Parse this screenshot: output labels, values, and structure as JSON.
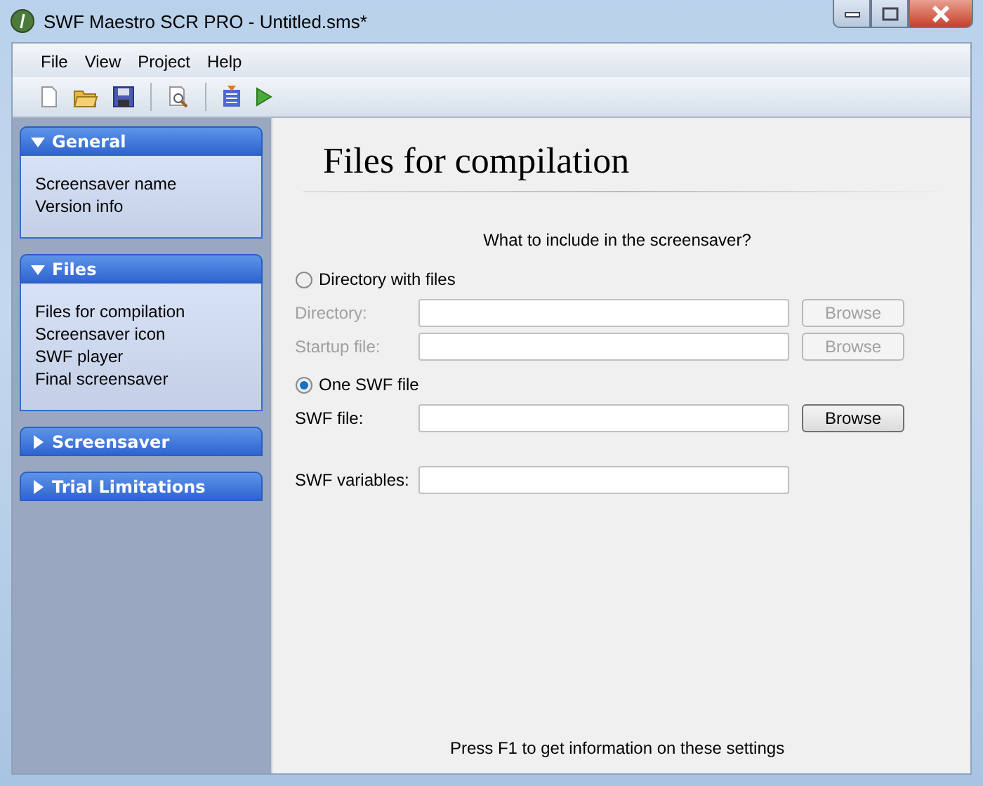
{
  "window": {
    "title": "SWF Maestro SCR PRO - Untitled.sms*"
  },
  "menu": [
    "File",
    "View",
    "Project",
    "Help"
  ],
  "sidebar": {
    "groups": [
      {
        "title": "General",
        "expanded": true,
        "items": [
          "Screensaver name",
          "Version info"
        ]
      },
      {
        "title": "Files",
        "expanded": true,
        "items": [
          "Files for compilation",
          "Screensaver icon",
          "SWF player",
          "Final screensaver"
        ]
      },
      {
        "title": "Screensaver",
        "expanded": false
      },
      {
        "title": "Trial Limitations",
        "expanded": false
      }
    ]
  },
  "page": {
    "heading": "Files for compilation",
    "prompt": "What to include in the screensaver?",
    "sources": [
      {
        "label": "Directory with files",
        "selected": false,
        "fields": [
          {
            "label": "Directory:",
            "button": "Browse"
          },
          {
            "label": "Startup file:",
            "button": "Browse"
          }
        ]
      },
      {
        "label": "One SWF file",
        "selected": true,
        "fields": [
          {
            "label": "SWF file:",
            "button": "Browse"
          }
        ]
      }
    ],
    "extra_fields": [
      {
        "label": "SWF variables:"
      }
    ],
    "hint": "Press F1 to get information on these settings"
  }
}
